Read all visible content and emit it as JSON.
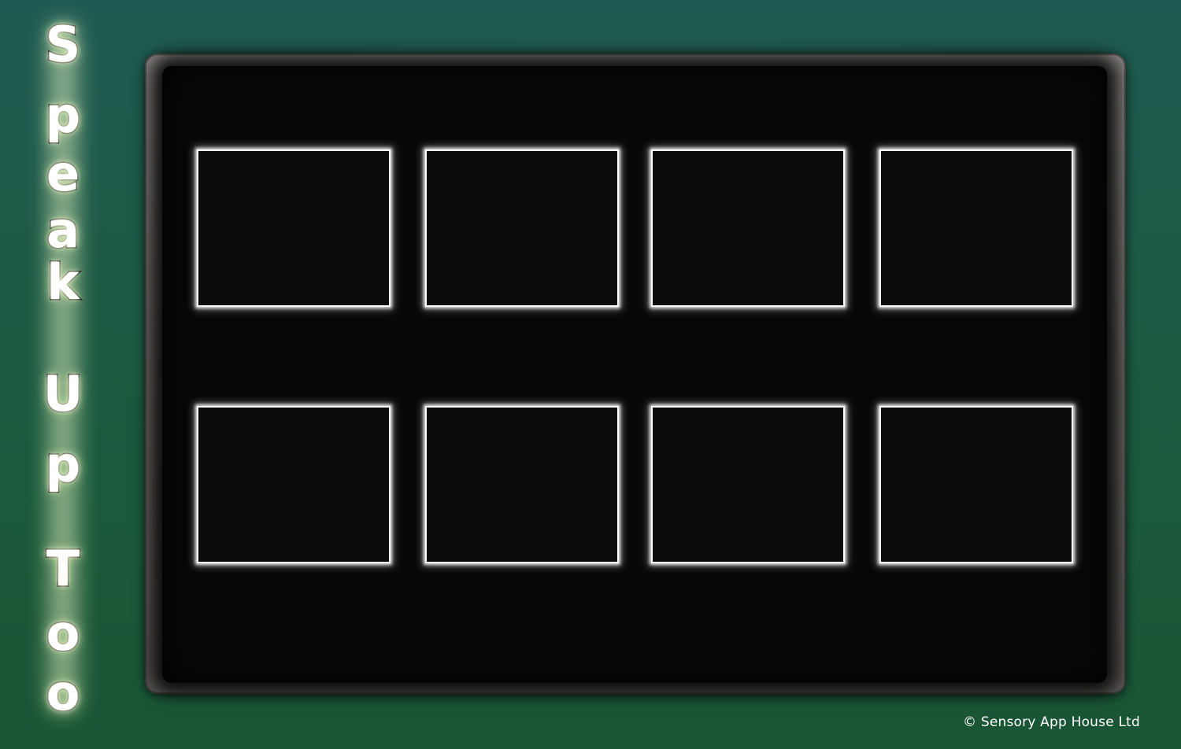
{
  "app": {
    "title_words": [
      "Speak",
      "Up",
      "Too"
    ],
    "title_letters": [
      "S",
      "p",
      "e",
      "a",
      "k",
      "U",
      "p",
      "T",
      "o",
      "o"
    ]
  },
  "board": {
    "rows": 2,
    "columns": 4,
    "tiles": [
      {
        "id": "tile-1",
        "label": ""
      },
      {
        "id": "tile-2",
        "label": ""
      },
      {
        "id": "tile-3",
        "label": ""
      },
      {
        "id": "tile-4",
        "label": ""
      },
      {
        "id": "tile-5",
        "label": ""
      },
      {
        "id": "tile-6",
        "label": ""
      },
      {
        "id": "tile-7",
        "label": ""
      },
      {
        "id": "tile-8",
        "label": ""
      }
    ]
  },
  "footer": {
    "copyright": "© Sensory App House Ltd"
  },
  "colors": {
    "background": "#1d5a47",
    "board_frame": "#7a7675",
    "board_inner": "#070707",
    "tile_border": "#ffffff",
    "title_text": "#ffffff"
  }
}
